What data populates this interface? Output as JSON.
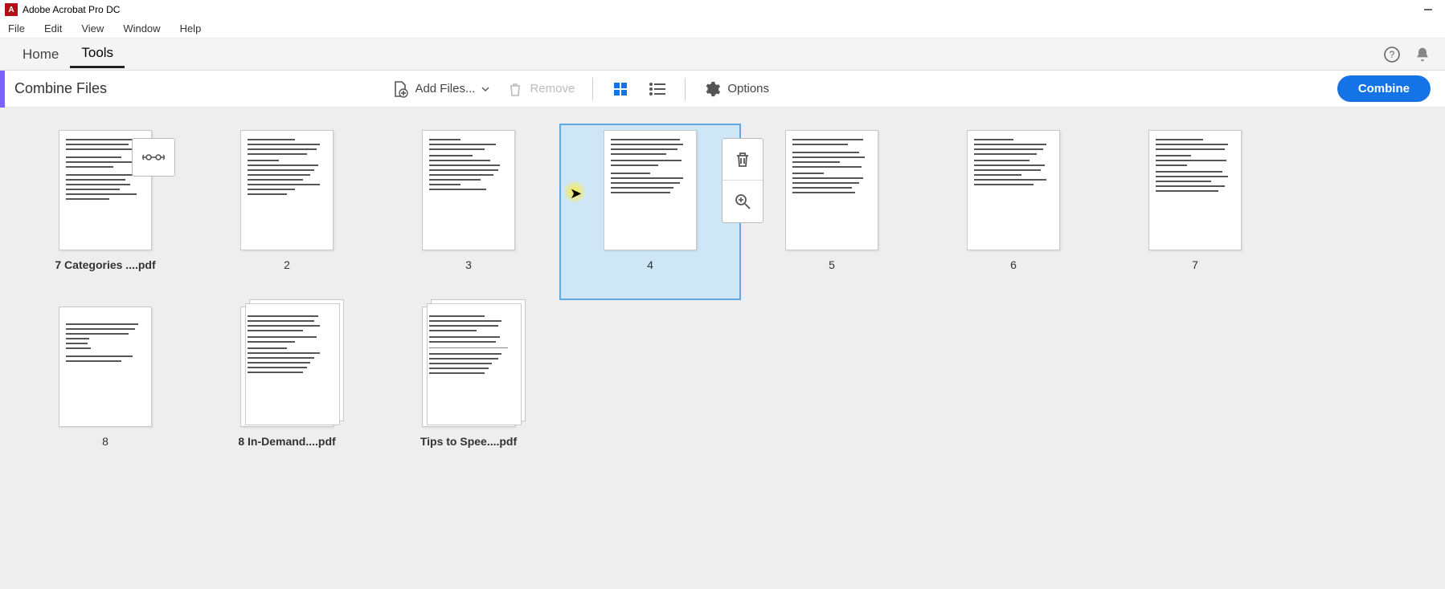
{
  "titlebar": {
    "app_name": "Adobe Acrobat Pro DC"
  },
  "menubar": {
    "items": [
      "File",
      "Edit",
      "View",
      "Window",
      "Help"
    ]
  },
  "apptabs": {
    "home": "Home",
    "tools": "Tools"
  },
  "toolbar": {
    "section_title": "Combine Files",
    "add_files": "Add Files...",
    "remove": "Remove",
    "options": "Options",
    "combine": "Combine"
  },
  "thumbnails": {
    "row1": [
      {
        "label": "7 Categories ....pdf",
        "bold": true
      },
      {
        "label": "2"
      },
      {
        "label": "3"
      },
      {
        "label": "4",
        "selected": true
      },
      {
        "label": "5"
      },
      {
        "label": "6"
      },
      {
        "label": "7"
      }
    ],
    "row2": [
      {
        "label": "8"
      },
      {
        "label": "8 In-Demand....pdf",
        "bold": true,
        "stack": true
      },
      {
        "label": "Tips to Spee....pdf",
        "bold": true,
        "stack": true
      }
    ]
  }
}
